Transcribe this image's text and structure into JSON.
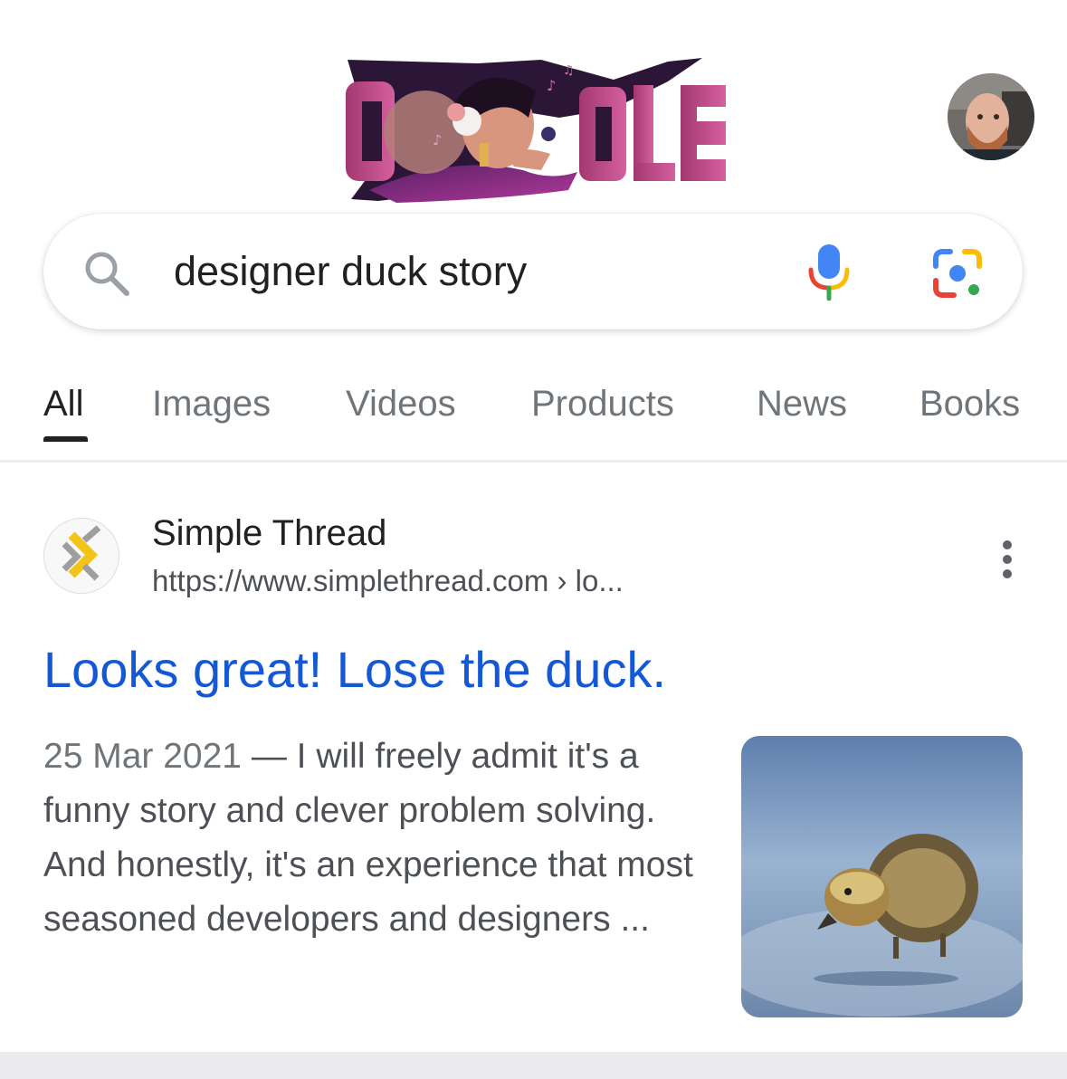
{
  "search": {
    "query": "designer duck story",
    "placeholder": "",
    "icons": {
      "search": "search-icon",
      "mic": "microphone-icon",
      "lens": "google-lens-icon"
    }
  },
  "doodle": {
    "alt": "Google Doodle",
    "colors": {
      "purple": "#8b2a8a",
      "pink": "#c2488e",
      "dark": "#2b1638"
    }
  },
  "account": {
    "avatar": "avatar"
  },
  "tabs": {
    "all": "All",
    "images": "Images",
    "videos": "Videos",
    "products": "Products",
    "news": "News",
    "books": "Books",
    "active": "All"
  },
  "result": {
    "site_name": "Simple Thread",
    "url": "https://www.simplethread.com › lo...",
    "title": "Looks great! Lose the duck.",
    "date": "25 Mar 2021",
    "separator": " — ",
    "snippet": "I will freely admit it's a funny story and clever problem solving. And honestly, it's an experience that most seasoned developers and designers ...",
    "menu_icon": "more-vert-icon",
    "colors": {
      "link": "#1558d6",
      "text": "#4d5156"
    }
  }
}
